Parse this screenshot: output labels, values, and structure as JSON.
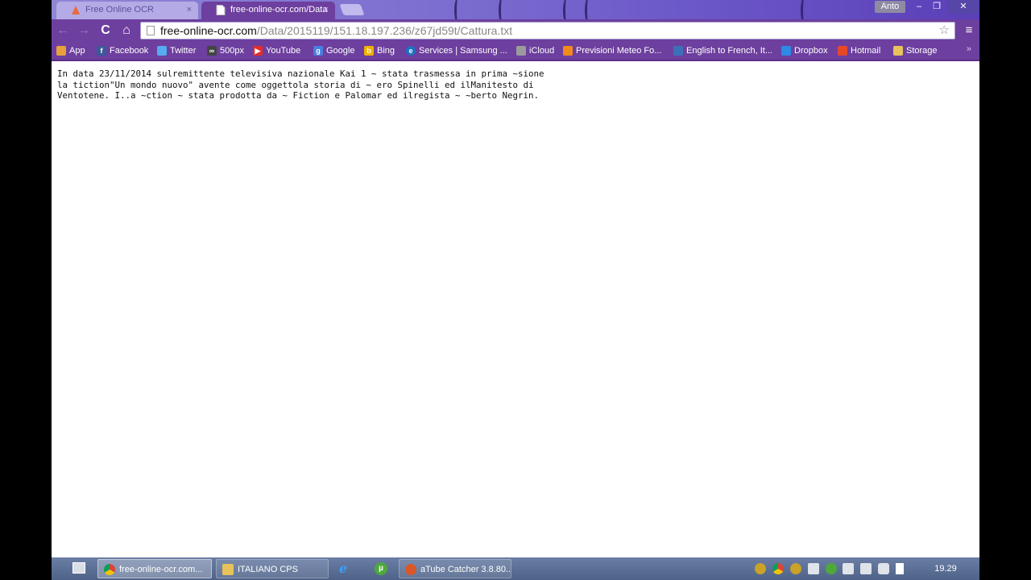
{
  "browser": {
    "profile_name": "Anto",
    "tabs": [
      {
        "label": "Free Online OCR",
        "close": "×",
        "active": false
      },
      {
        "label": "free-online-ocr.com/Data",
        "close": "×",
        "active": true
      }
    ],
    "window_controls": {
      "minimize": "–",
      "restore": "❐",
      "close": "✕"
    },
    "nav": {
      "back": "←",
      "forward": "→",
      "reload": "C",
      "home": "⌂",
      "menu": "≡"
    },
    "address": {
      "host": "free-online-ocr.com",
      "path": "/Data/2015119/151.18.197.236/z67jd59t/Cattura.txt",
      "star": "☆"
    },
    "bookmarks": [
      {
        "label": "App",
        "icon": "apps-grid-icon",
        "color": "#e8a13a"
      },
      {
        "label": "Facebook",
        "icon": "facebook-icon",
        "color": "#3b5998"
      },
      {
        "label": "Twitter",
        "icon": "twitter-icon",
        "color": "#55acee"
      },
      {
        "label": "500px",
        "icon": "500px-icon",
        "color": "#444444"
      },
      {
        "label": "YouTube",
        "icon": "youtube-icon",
        "color": "#e52d27"
      },
      {
        "label": "Google",
        "icon": "google-icon",
        "color": "#4a7fe0"
      },
      {
        "label": "Bing",
        "icon": "bing-icon",
        "color": "#f2b100"
      },
      {
        "label": "Services | Samsung ...",
        "icon": "samsung-icon",
        "color": "#1f70c1"
      },
      {
        "label": "iCloud",
        "icon": "apple-icon",
        "color": "#9a9a9a"
      },
      {
        "label": "Previsioni Meteo Fo...",
        "icon": "weather-icon",
        "color": "#f08a1c"
      },
      {
        "label": "English to French, It...",
        "icon": "translate-icon",
        "color": "#3d6fb8"
      },
      {
        "label": "Dropbox",
        "icon": "dropbox-icon",
        "color": "#2d8ae5"
      },
      {
        "label": "Hotmail",
        "icon": "windows-icon",
        "color": "#e8482a"
      },
      {
        "label": "Storage",
        "icon": "folder-icon",
        "color": "#e8c25a"
      }
    ],
    "bookmarks_more": "»"
  },
  "document": {
    "lines": [
      "In data 23/11/2014 sulremittente televisiva nazionale Kai 1 ~ stata trasmessa in prima ~sione",
      "la tiction\"Un mondo nuovo\" avente come oggettola storia di ~ ero Spinelli ed ilManitesto di",
      "Ventotene. I..a ~ction ~ stata prodotta da ~ Fiction e Palomar ed ilregista ~ ~berto Negrin."
    ]
  },
  "taskbar": {
    "items": [
      {
        "label": "free-online-ocr.com...",
        "icon": "chrome-icon",
        "active": true
      },
      {
        "label": "ITALIANO CPS",
        "icon": "folder-icon",
        "active": false
      },
      {
        "label": "aTube Catcher 3.8.80...",
        "icon": "atube-catcher-icon",
        "active": false
      }
    ],
    "ie_glyph": "e",
    "utorrent_glyph": "µ",
    "clock": "19.29"
  }
}
